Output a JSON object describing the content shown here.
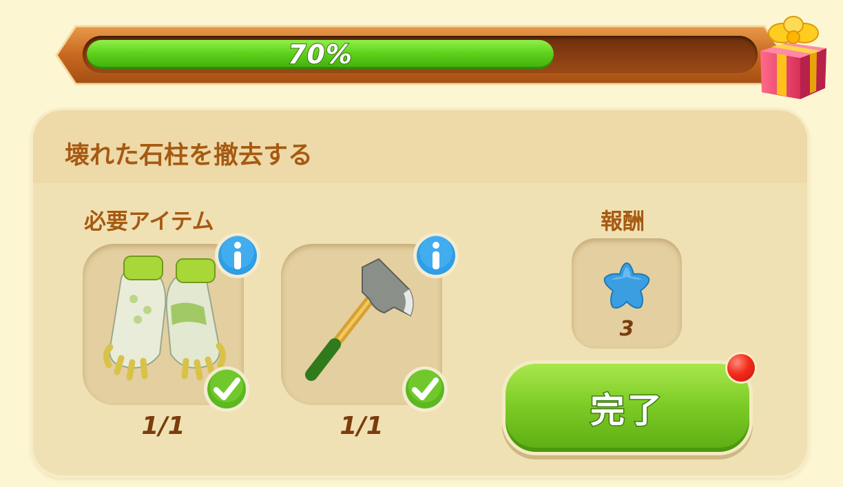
{
  "progress": {
    "percent_label": "70%",
    "value": 0.7,
    "reward_icon": "gift-box-icon"
  },
  "quest": {
    "title": "壊れた石柱を撤去する",
    "required_items_label": "必要アイテム",
    "reward_label": "報酬",
    "items": [
      {
        "icon": "gloves-icon",
        "count": "1/1",
        "info_icon": "info-icon",
        "status_icon": "check-icon"
      },
      {
        "icon": "axe-icon",
        "count": "1/1",
        "info_icon": "info-icon",
        "status_icon": "check-icon"
      }
    ],
    "reward": {
      "icon": "blue-star-icon",
      "count": "3"
    },
    "complete_button": "完了"
  },
  "colors": {
    "background": "#fcf6d2",
    "title_text": "#a65a12",
    "progress_green": "#5fd21c",
    "button_green": "#7fcc27",
    "badge_red": "#f22c1c"
  }
}
